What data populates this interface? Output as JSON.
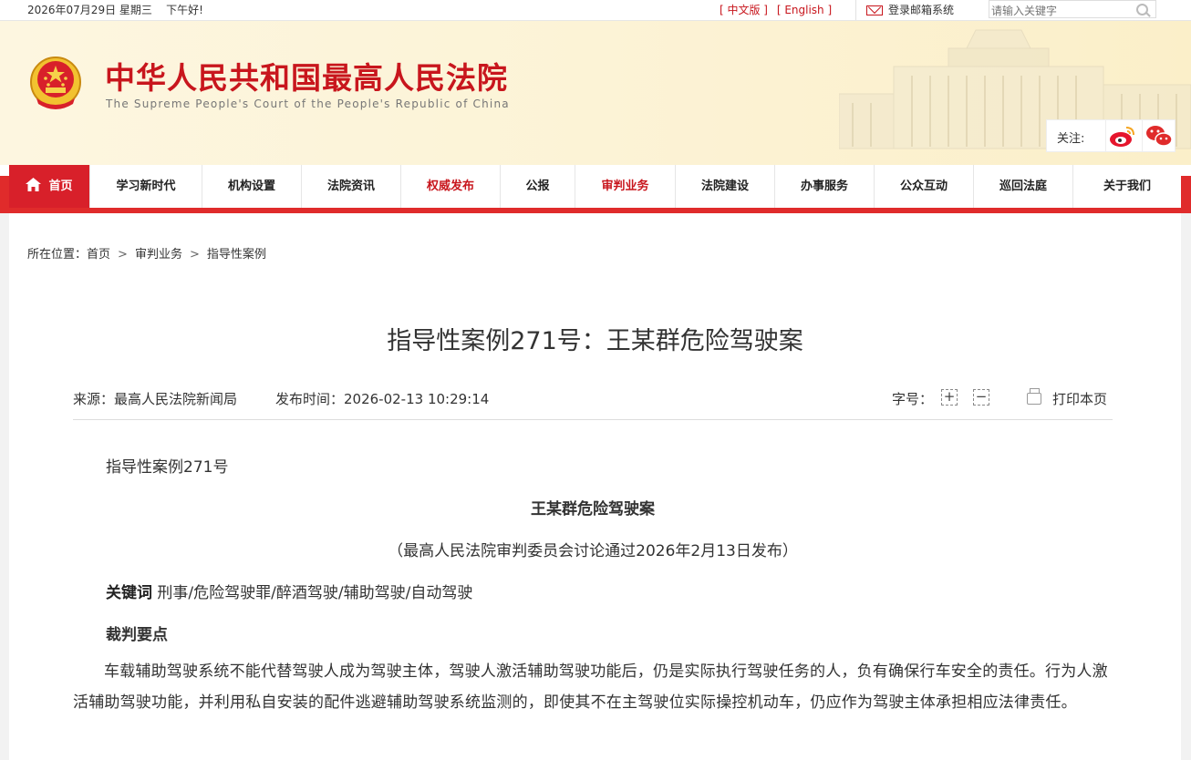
{
  "topbar": {
    "date": "2026年07月29日 星期三",
    "greeting": "下午好!",
    "lang_cn": "[ 中文版 ]",
    "lang_en": "[ English ]",
    "mail_label": "登录邮箱系统",
    "search_placeholder": "请输入关键字"
  },
  "header": {
    "title": "中华人民共和国最高人民法院",
    "subtitle": "The Supreme People's Court of the People's Republic of China",
    "follow_label": "关注:",
    "colors": {
      "brand_red": "#c8161d",
      "nav_red": "#e02b2b"
    }
  },
  "nav": {
    "items": [
      {
        "label": "首页",
        "icon": "home-icon"
      },
      {
        "label": "学习新时代"
      },
      {
        "label": "机构设置"
      },
      {
        "label": "法院资讯"
      },
      {
        "label": "权威发布"
      },
      {
        "label": "公报"
      },
      {
        "label": "审判业务"
      },
      {
        "label": "法院建设"
      },
      {
        "label": "办事服务"
      },
      {
        "label": "公众互动"
      },
      {
        "label": "巡回法庭"
      },
      {
        "label": "关于我们"
      }
    ]
  },
  "breadcrumb": {
    "prefix": "所在位置：",
    "items": [
      "首页",
      "审判业务",
      "指导性案例"
    ]
  },
  "article": {
    "title": "指导性案例271号：王某群危险驾驶案",
    "source": "来源：最高人民法院新闻局",
    "publish_time": "发布时间：2026-02-13 10:29:14",
    "font_size_label": "字号：",
    "font_plus": "+",
    "font_minus": "−",
    "print_label": "打印本页",
    "case_no": "指导性案例271号",
    "case_title": "王某群危险驾驶案",
    "issued": "（最高人民法院审判委员会讨论通过2026年2月13日发布）",
    "keywords_label": "关键词",
    "keywords": "刑事/危险驾驶罪/醉酒驾驶/辅助驾驶/自动驾驶",
    "holding_label": "裁判要点",
    "holding_text": "车载辅助驾驶系统不能代替驾驶人成为驾驶主体，驾驶人激活辅助驾驶功能后，仍是实际执行驾驶任务的人，负有确保行车安全的责任。行为人激活辅助驾驶功能，并利用私自安装的配件逃避辅助驾驶系统监测的，即使其不在主驾驶位实际操控机动车，仍应作为驾驶主体承担相应法律责任。"
  }
}
